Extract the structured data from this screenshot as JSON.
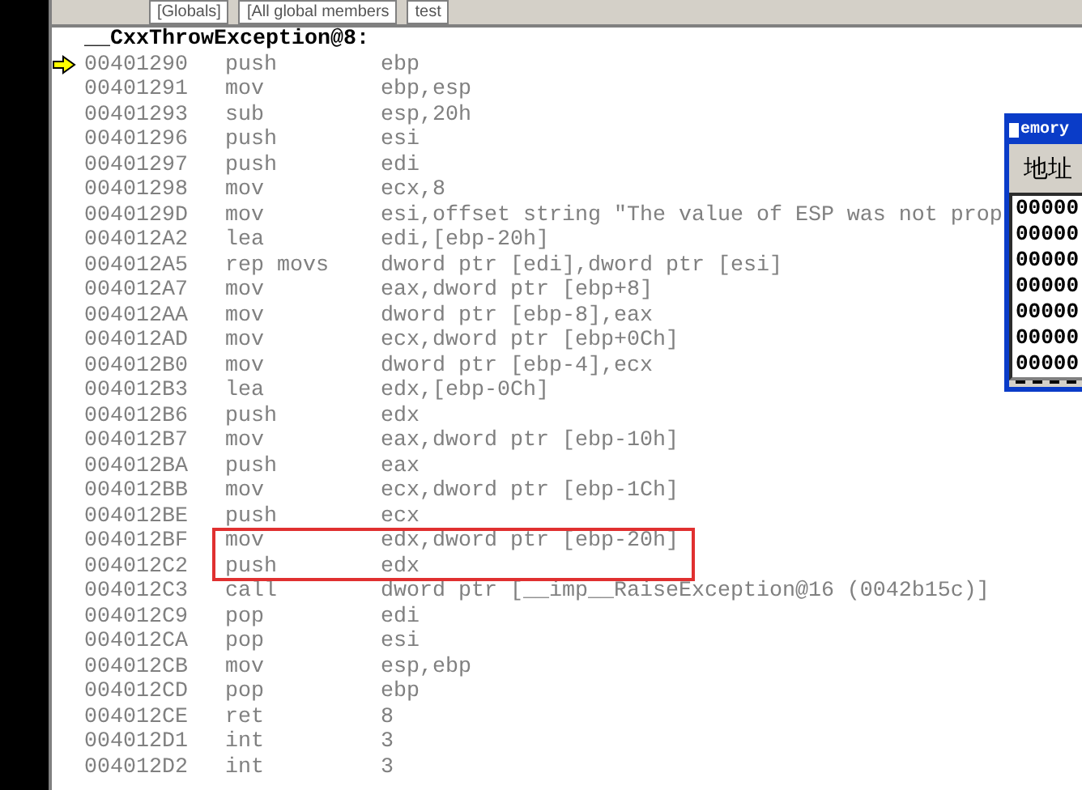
{
  "toolbar": {
    "combos": [
      {
        "text": "[Globals]"
      },
      {
        "text": "[All global members"
      },
      {
        "text": "test"
      }
    ]
  },
  "disassembly": {
    "label": "__CxxThrowException@8:",
    "rows": [
      {
        "address": "00401290",
        "mnemonic": "push",
        "operands": "ebp",
        "current": true,
        "highlighted": false
      },
      {
        "address": "00401291",
        "mnemonic": "mov",
        "operands": "ebp,esp",
        "current": false,
        "highlighted": false
      },
      {
        "address": "00401293",
        "mnemonic": "sub",
        "operands": "esp,20h",
        "current": false,
        "highlighted": false
      },
      {
        "address": "00401296",
        "mnemonic": "push",
        "operands": "esi",
        "current": false,
        "highlighted": false
      },
      {
        "address": "00401297",
        "mnemonic": "push",
        "operands": "edi",
        "current": false,
        "highlighted": false
      },
      {
        "address": "00401298",
        "mnemonic": "mov",
        "operands": "ecx,8",
        "current": false,
        "highlighted": false
      },
      {
        "address": "0040129D",
        "mnemonic": "mov",
        "operands": "esi,offset string \"The value of ESP was not prop",
        "current": false,
        "highlighted": false
      },
      {
        "address": "004012A2",
        "mnemonic": "lea",
        "operands": "edi,[ebp-20h]",
        "current": false,
        "highlighted": false
      },
      {
        "address": "004012A5",
        "mnemonic": "rep movs",
        "operands": "dword ptr [edi],dword ptr [esi]",
        "current": false,
        "highlighted": false
      },
      {
        "address": "004012A7",
        "mnemonic": "mov",
        "operands": "eax,dword ptr [ebp+8]",
        "current": false,
        "highlighted": false
      },
      {
        "address": "004012AA",
        "mnemonic": "mov",
        "operands": "dword ptr [ebp-8],eax",
        "current": false,
        "highlighted": false
      },
      {
        "address": "004012AD",
        "mnemonic": "mov",
        "operands": "ecx,dword ptr [ebp+0Ch]",
        "current": false,
        "highlighted": false
      },
      {
        "address": "004012B0",
        "mnemonic": "mov",
        "operands": "dword ptr [ebp-4],ecx",
        "current": false,
        "highlighted": false
      },
      {
        "address": "004012B3",
        "mnemonic": "lea",
        "operands": "edx,[ebp-0Ch]",
        "current": false,
        "highlighted": false
      },
      {
        "address": "004012B6",
        "mnemonic": "push",
        "operands": "edx",
        "current": false,
        "highlighted": false
      },
      {
        "address": "004012B7",
        "mnemonic": "mov",
        "operands": "eax,dword ptr [ebp-10h]",
        "current": false,
        "highlighted": false
      },
      {
        "address": "004012BA",
        "mnemonic": "push",
        "operands": "eax",
        "current": false,
        "highlighted": false
      },
      {
        "address": "004012BB",
        "mnemonic": "mov",
        "operands": "ecx,dword ptr [ebp-1Ch]",
        "current": false,
        "highlighted": false
      },
      {
        "address": "004012BE",
        "mnemonic": "push",
        "operands": "ecx",
        "current": false,
        "highlighted": false
      },
      {
        "address": "004012BF",
        "mnemonic": "mov",
        "operands": "edx,dword ptr [ebp-20h]",
        "current": false,
        "highlighted": true
      },
      {
        "address": "004012C2",
        "mnemonic": "push",
        "operands": "edx",
        "current": false,
        "highlighted": true
      },
      {
        "address": "004012C3",
        "mnemonic": "call",
        "operands": "dword ptr [__imp__RaiseException@16 (0042b15c)]",
        "current": false,
        "highlighted": false
      },
      {
        "address": "004012C9",
        "mnemonic": "pop",
        "operands": "edi",
        "current": false,
        "highlighted": false
      },
      {
        "address": "004012CA",
        "mnemonic": "pop",
        "operands": "esi",
        "current": false,
        "highlighted": false
      },
      {
        "address": "004012CB",
        "mnemonic": "mov",
        "operands": "esp,ebp",
        "current": false,
        "highlighted": false
      },
      {
        "address": "004012CD",
        "mnemonic": "pop",
        "operands": "ebp",
        "current": false,
        "highlighted": false
      },
      {
        "address": "004012CE",
        "mnemonic": "ret",
        "operands": "8",
        "current": false,
        "highlighted": false
      },
      {
        "address": "004012D1",
        "mnemonic": "int",
        "operands": "3",
        "current": false,
        "highlighted": false
      },
      {
        "address": "004012D2",
        "mnemonic": "int",
        "operands": "3",
        "current": false,
        "highlighted": false
      }
    ]
  },
  "memory_window": {
    "title": "emory",
    "header": "地址",
    "rows": [
      "00000",
      "00000",
      "00000",
      "00000",
      "00000",
      "00000",
      "00000"
    ]
  }
}
